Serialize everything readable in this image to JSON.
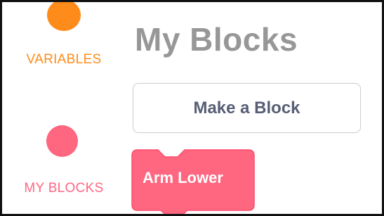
{
  "categories": [
    {
      "id": "variables",
      "label": "VARIABLES",
      "color": "#ff8c1a"
    },
    {
      "id": "my-blocks",
      "label": "MY BLOCKS",
      "color": "#ff6680"
    }
  ],
  "palette": {
    "title": "My Blocks",
    "make_block_label": "Make a Block",
    "blocks": [
      {
        "label": "Arm Lower",
        "color": "#ff6680",
        "border_color": "#ff4d6a"
      }
    ]
  },
  "colors": {
    "variables_text": "#ff8c1a",
    "my_blocks_text": "#ff6680",
    "title_text": "#979797",
    "button_text": "#575e75",
    "button_border": "#c8cbd2"
  }
}
